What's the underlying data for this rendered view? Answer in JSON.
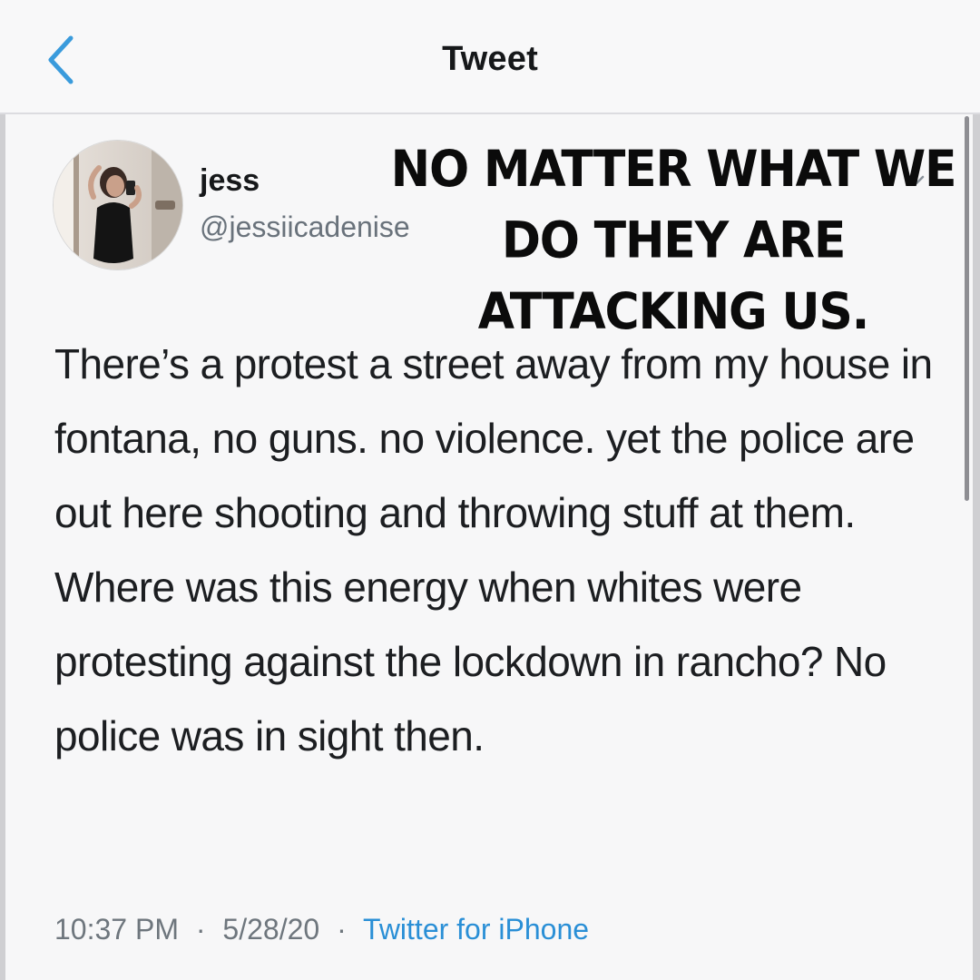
{
  "header": {
    "title": "Tweet",
    "back_icon": "chevron-left-icon",
    "accent_color": "#3a9bdc"
  },
  "author": {
    "name": "jess",
    "handle": "@jessiicadenise"
  },
  "overlay_caption": {
    "line1": "No matter what we",
    "line2": "do they are",
    "line3": "attacking us."
  },
  "tweet": {
    "text": "There’s a protest a street away from my house in fontana, no guns. no violence. yet the police are out here shooting and throwing stuff at them. Where was this energy when whites were protesting against the lockdown in rancho? No police was in sight then."
  },
  "meta": {
    "time": "10:37 PM",
    "date": "5/28/20",
    "separator": "·",
    "source": "Twitter for iPhone",
    "source_color": "#2a8fd6"
  }
}
